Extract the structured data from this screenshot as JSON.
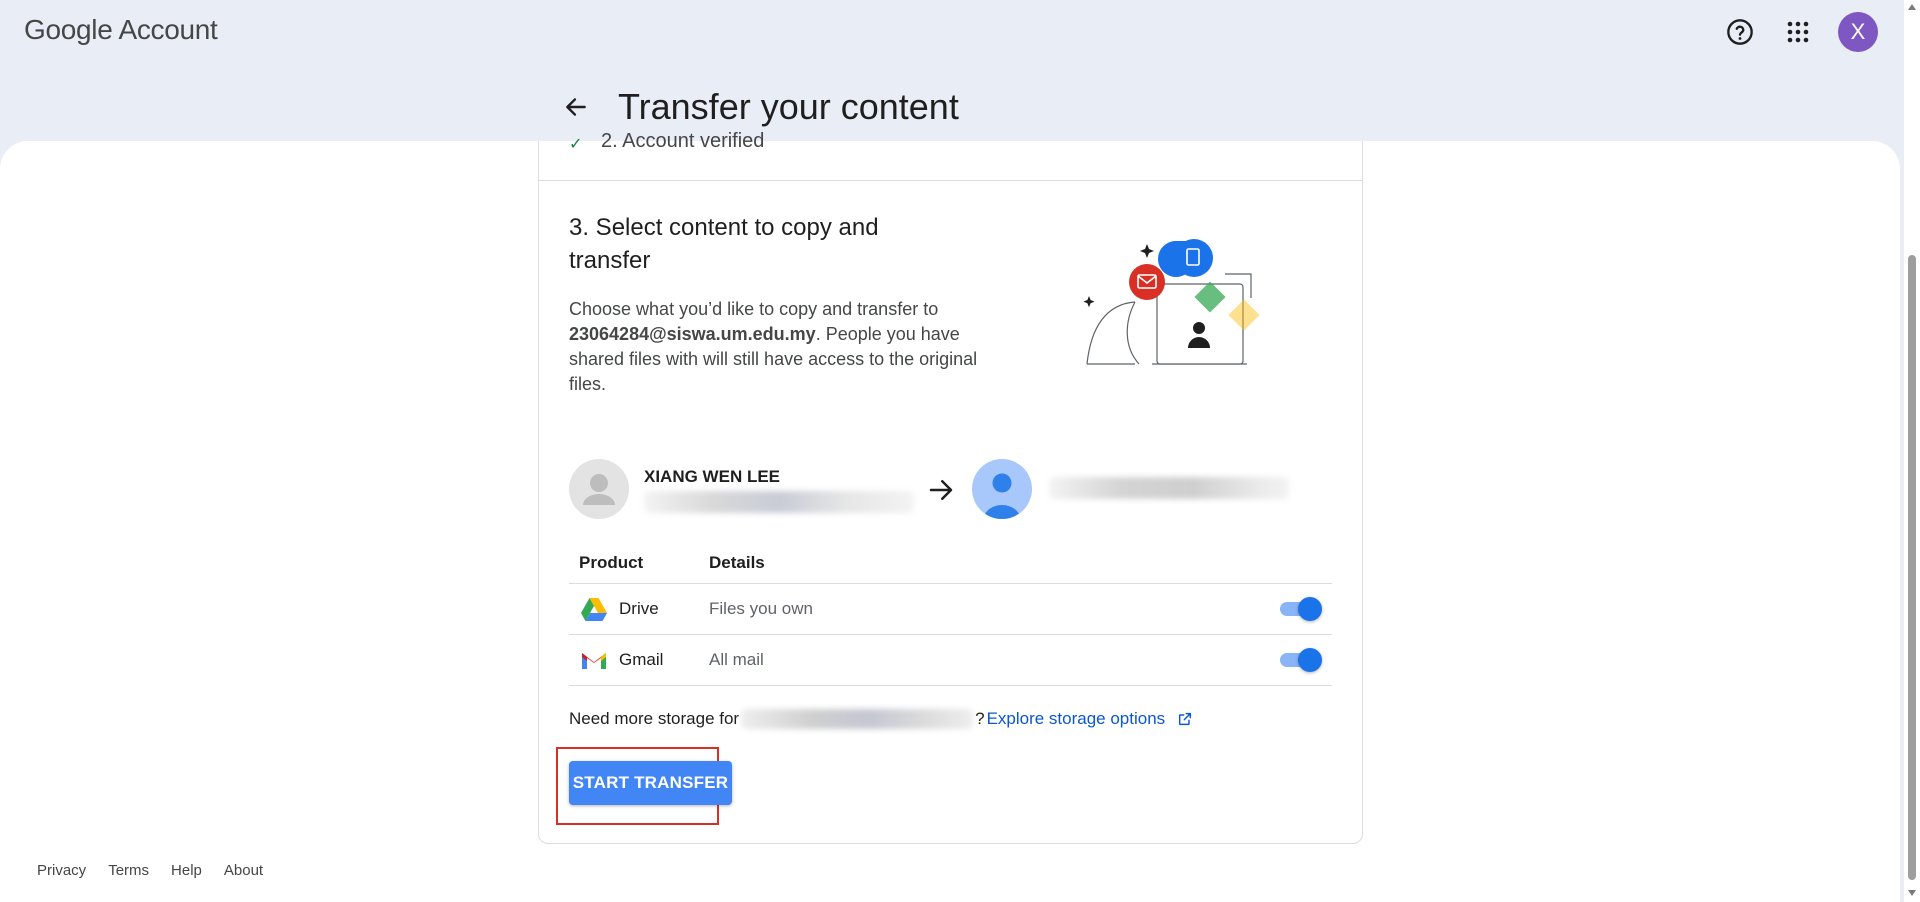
{
  "header": {
    "logo_google": "Google",
    "logo_account": "Account",
    "help_icon": "help-circle-icon",
    "apps_icon": "apps-grid-icon",
    "avatar_letter": "X",
    "avatar_color": "#7e57c2"
  },
  "page": {
    "title": "Transfer your content",
    "back_icon": "arrow-left-icon"
  },
  "prev_step": {
    "label": "2. Account verified"
  },
  "step": {
    "title": "3. Select content to copy and transfer",
    "desc_prefix": "Choose what you’d like to copy and transfer to ",
    "desc_email": "23064284@siswa.um.edu.my",
    "desc_suffix": ". People you have shared files with will still have access to the original files."
  },
  "accounts": {
    "source_name": "XIANG WEN LEE",
    "arrow_icon": "arrow-right-icon"
  },
  "table": {
    "headers": [
      "Product",
      "Details"
    ],
    "rows": [
      {
        "product": "Drive",
        "details": "Files you own",
        "icon": "google-drive-icon",
        "enabled": true
      },
      {
        "product": "Gmail",
        "details": "All mail",
        "icon": "gmail-icon",
        "enabled": true
      }
    ]
  },
  "storage": {
    "prefix": "Need more storage for",
    "suffix": "?",
    "link": "Explore storage options",
    "link_icon": "external-link-icon"
  },
  "cta": {
    "label": "START TRANSFER",
    "color": "#4285f4"
  },
  "footer": {
    "links": [
      "Privacy",
      "Terms",
      "Help",
      "About"
    ]
  }
}
